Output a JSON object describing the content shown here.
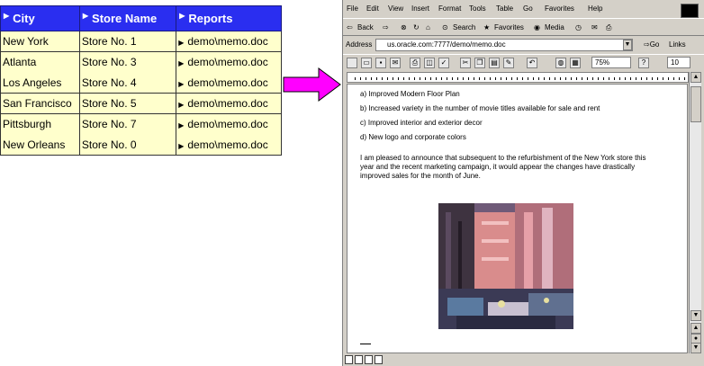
{
  "report_table": {
    "headers": [
      "City",
      "Store Name",
      "Reports"
    ],
    "rows": [
      {
        "city": "New York",
        "store": "Store No. 1",
        "report": "demo\\memo.doc"
      },
      {
        "city": "Atlanta",
        "store": "Store No. 3",
        "report": "demo\\memo.doc"
      },
      {
        "city": "Los Angeles",
        "store": "Store No. 4",
        "report": "demo\\memo.doc"
      },
      {
        "city": "San Francisco",
        "store": "Store No. 5",
        "report": "demo\\memo.doc"
      },
      {
        "city": "Pittsburgh",
        "store": "Store No. 7",
        "report": "demo\\memo.doc"
      },
      {
        "city": "New Orleans",
        "store": "Store No. 0",
        "report": "demo\\memo.doc"
      }
    ],
    "colors": {
      "header_bg": "#2a2ef0",
      "cell_bg": "#ffffcc"
    }
  },
  "arrow": {
    "color": "#ff00ff",
    "icon": "right-arrow-icon"
  },
  "browser": {
    "menu": [
      "File",
      "Edit",
      "View",
      "Insert",
      "Format",
      "Tools",
      "Table",
      "Go",
      "Favorites",
      "Help"
    ],
    "toolbar": {
      "back": "Back",
      "search": "Search",
      "favorites": "Favorites",
      "media": "Media"
    },
    "address_label": "Address",
    "address_value": "us.oracle.com:7777/demo/memo.doc",
    "go_label": "Go",
    "links_label": "Links",
    "zoom": "75%",
    "font_size": "10"
  },
  "document": {
    "bullets": [
      "a)  Improved Modern Floor Plan",
      "b)  Increased variety in the number of movie titles available for sale and rent",
      "c)  Improved interior and exterior decor",
      "d)  New logo and corporate colors"
    ],
    "paragraph": "I am pleased to announce that subsequent to the refurbishment of the New York store this year and the recent marketing campaign, it would appear the changes have drastically improved sales for the month of June."
  }
}
